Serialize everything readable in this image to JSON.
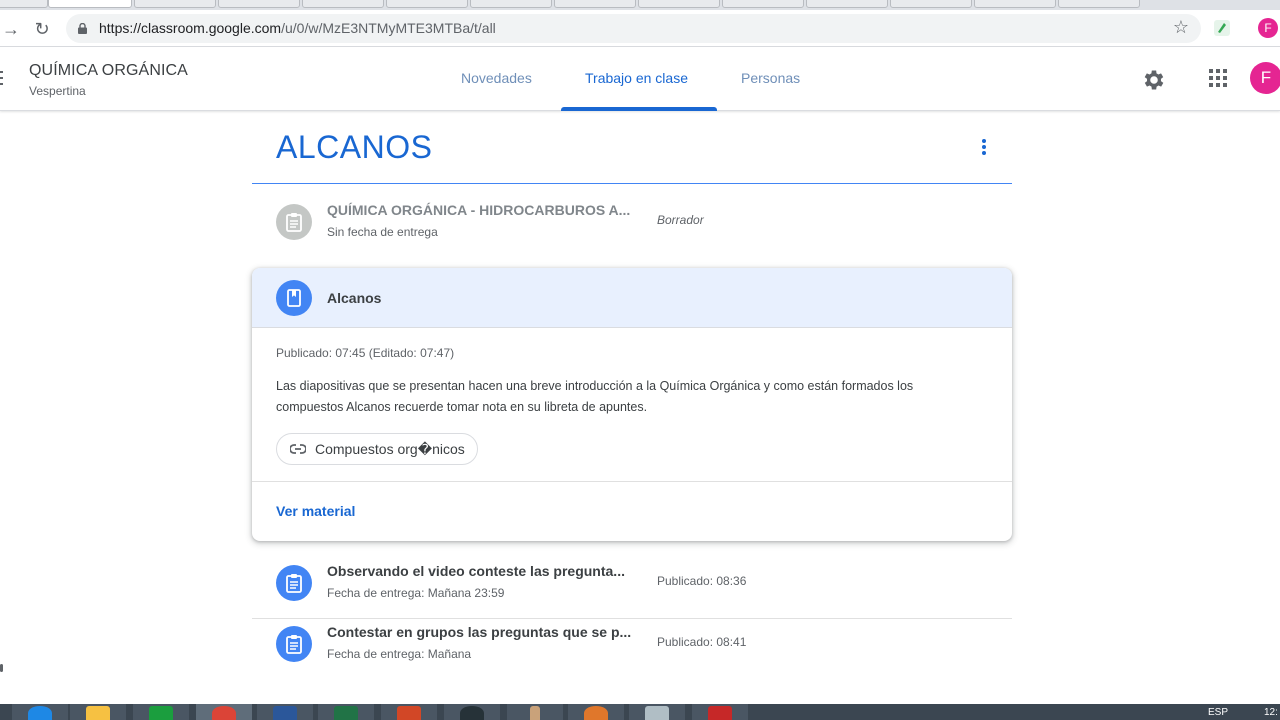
{
  "browser": {
    "url_host": "https://classroom.google.com",
    "url_path": "/u/0/w/MzE3NTMyMTE3MTBa/t/all",
    "profile_initial": "F"
  },
  "header": {
    "class_name": "QUÍMICA ORGÁNICA",
    "class_section": "Vespertina",
    "tabs": [
      {
        "label": "Novedades"
      },
      {
        "label": "Trabajo en clase"
      },
      {
        "label": "Personas"
      }
    ],
    "user_initial": "F"
  },
  "topic": {
    "title": "ALCANOS"
  },
  "items": [
    {
      "title": "QUÍMICA ORGÁNICA - HIDROCARBUROS A...",
      "subtitle": "Sin fecha de entrega",
      "meta": "Borrador"
    },
    {
      "title": "Observando el video conteste las pregunta...",
      "subtitle": "Fecha de entrega: Mañana 23:59",
      "meta": "Publicado: 08:36"
    },
    {
      "title": "Contestar en grupos las preguntas que se p...",
      "subtitle": "Fecha de entrega: Mañana",
      "meta": "Publicado: 08:41"
    }
  ],
  "material": {
    "title": "Alcanos",
    "published": "Publicado: 07:45 (Editado: 07:47)",
    "description": "Las diapositivas que se presentan hacen una breve introducción a la Química Orgánica y como están formados los compuestos Alcanos recuerde tomar nota en su libreta de apuntes.",
    "attachment": "Compuestos org�nicos",
    "view_label": "Ver material"
  },
  "taskbar": {
    "lang": "ESP",
    "clock": "12:"
  },
  "colors": {
    "accent": "#1967d2",
    "item_icon": "#4285f4",
    "card_header_bg": "#e8f0fe",
    "avatar": "#e52592"
  }
}
